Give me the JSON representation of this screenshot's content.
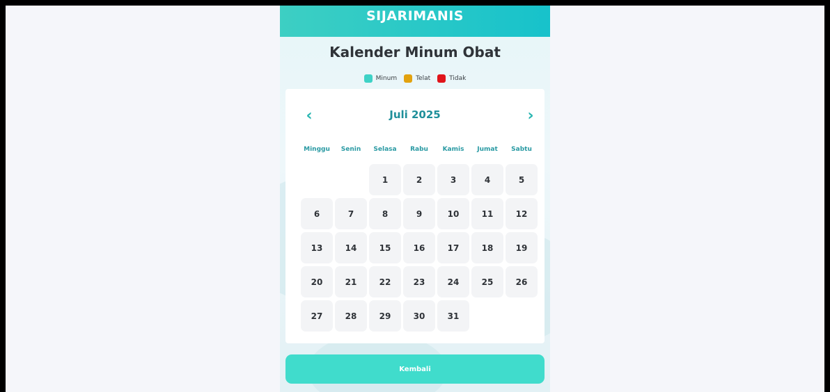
{
  "header": {
    "title": "SIJARIMANIS"
  },
  "page": {
    "title": "Kalender Minum Obat"
  },
  "legend": [
    {
      "label": "Minum",
      "color": "#3ed2c6"
    },
    {
      "label": "Telat",
      "color": "#e2a20f"
    },
    {
      "label": "Tidak",
      "color": "#e0141a"
    }
  ],
  "calendar": {
    "month_label": "Juli 2025",
    "prev_glyph": "‹",
    "next_glyph": "›",
    "weekdays": [
      "Minggu",
      "Senin",
      "Selasa",
      "Rabu",
      "Kamis",
      "Jumat",
      "Sabtu"
    ],
    "first_weekday_index": 2,
    "days": [
      "1",
      "2",
      "3",
      "4",
      "5",
      "6",
      "7",
      "8",
      "9",
      "10",
      "11",
      "12",
      "13",
      "14",
      "15",
      "16",
      "17",
      "18",
      "19",
      "20",
      "21",
      "22",
      "23",
      "24",
      "25",
      "26",
      "27",
      "28",
      "29",
      "30",
      "31"
    ]
  },
  "actions": {
    "back_label": "Kembali"
  },
  "colors": {
    "accent": "#3ed2c6",
    "month_text": "#1f8f9a"
  }
}
